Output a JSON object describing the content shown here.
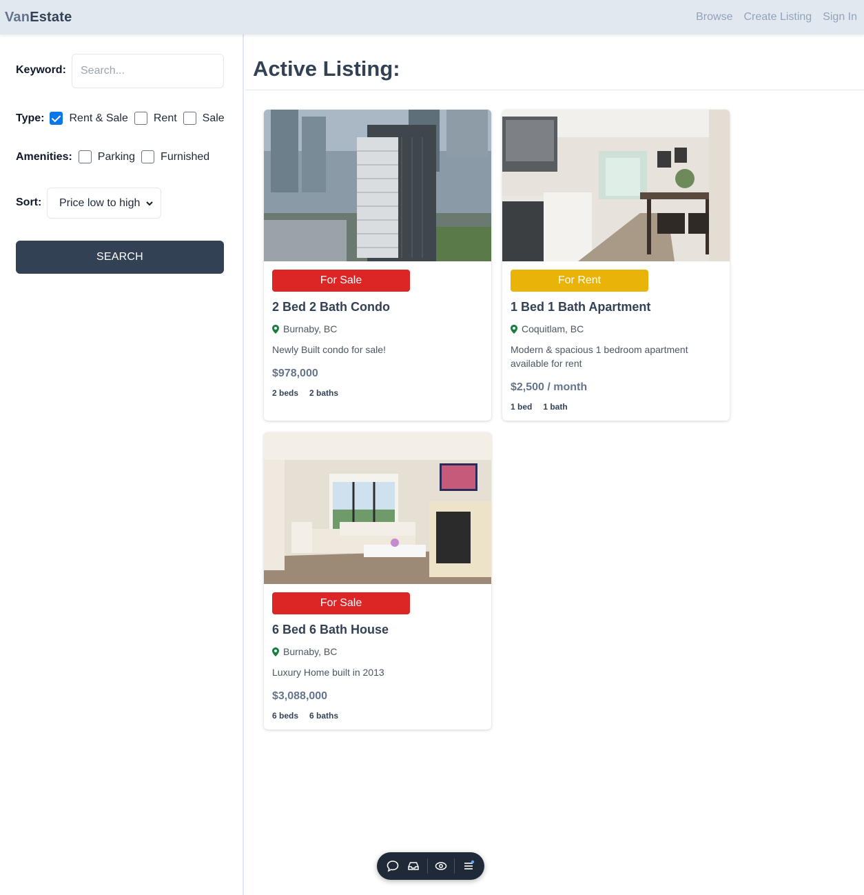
{
  "brand": {
    "part1": "Van",
    "part2": "Estate"
  },
  "nav": {
    "browse": "Browse",
    "create": "Create Listing",
    "signin": "Sign In"
  },
  "filters": {
    "keyword_label": "Keyword:",
    "keyword_placeholder": "Search...",
    "keyword_value": "",
    "type_label": "Type:",
    "type_options": [
      {
        "label": "Rent & Sale",
        "checked": true
      },
      {
        "label": "Rent",
        "checked": false
      },
      {
        "label": "Sale",
        "checked": false
      }
    ],
    "amenities_label": "Amenities:",
    "amenity_options": [
      {
        "label": "Parking",
        "checked": false
      },
      {
        "label": "Furnished",
        "checked": false
      }
    ],
    "sort_label": "Sort:",
    "sort_value": "Price low to high",
    "search_button": "SEARCH"
  },
  "main": {
    "heading": "Active Listing:"
  },
  "listings": [
    {
      "badge": "For Sale",
      "badge_type": "sale",
      "title": "2 Bed 2 Bath Condo",
      "location": "Burnaby, BC",
      "description": "Newly Built condo for sale!",
      "price": "$978,000",
      "beds": "2 beds",
      "baths": "2 baths",
      "image": "aerial-highrise-photo"
    },
    {
      "badge": "For Rent",
      "badge_type": "rent",
      "title": "1 Bed 1 Bath Apartment",
      "location": "Coquitlam, BC",
      "description": "Modern & spacious 1 bedroom apartment available for rent",
      "price": "$2,500 / month",
      "beds": "1 bed",
      "baths": "1 bath",
      "image": "kitchen-interior-photo"
    },
    {
      "badge": "For Sale",
      "badge_type": "sale",
      "title": "6 Bed 6 Bath House",
      "location": "Burnaby, BC",
      "description": "Luxury Home built in 2013",
      "price": "$3,088,000",
      "beds": "6 beds",
      "baths": "6 baths",
      "image": "living-room-photo"
    }
  ],
  "colors": {
    "sale": "#dc2626",
    "rent": "#eab308",
    "primary": "#334155",
    "topbar": "#e2e8f0",
    "pin": "#15803d"
  },
  "dock_icons": [
    "chat-icon",
    "inbox-icon",
    "eye-icon",
    "menu-icon"
  ]
}
